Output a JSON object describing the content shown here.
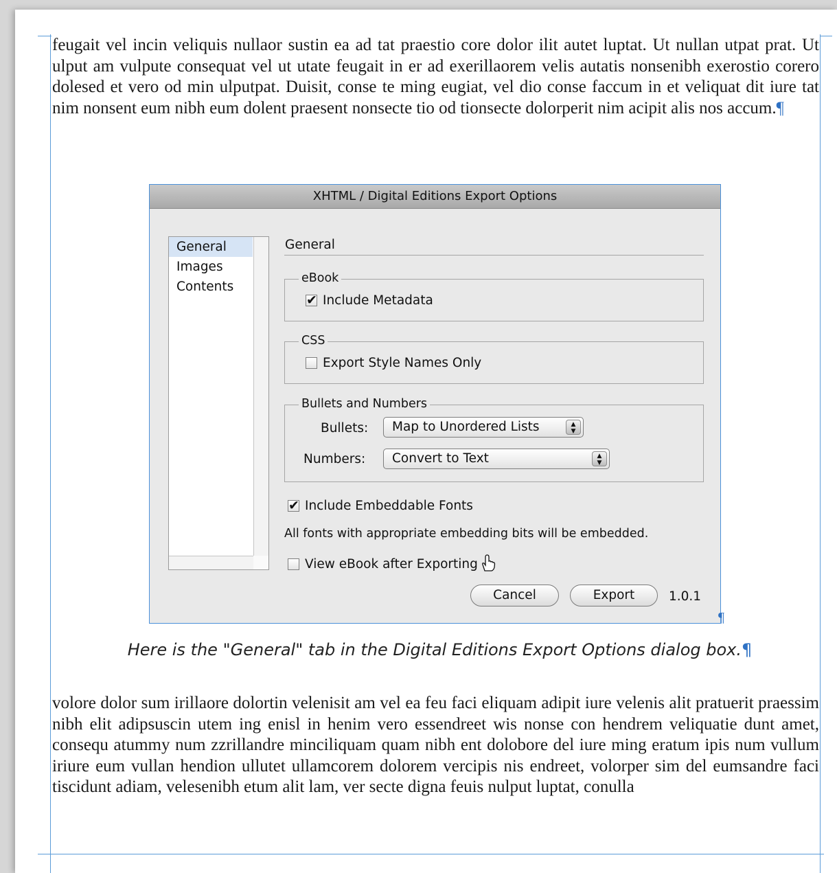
{
  "paragraph_top": "feugait vel incin veliquis nullaor sustin ea ad tat praestio core dolor ilit autet luptat. Ut nullan utpat prat. Ut ulput am vulpute consequat vel ut utate feugait in er ad exerillaorem velis autatis nonsenibh exerostio corero dolesed et vero od min ulputpat. Duisit, conse te ming eugiat, vel dio conse faccum in et veliquat dit iure tat nim nonsent eum nibh eum dolent praesent nonsecte tio od tionsecte dolorperit nim acipit alis nos accum.",
  "pilcrow": "¶",
  "dialog": {
    "title": "XHTML / Digital Editions Export Options",
    "sidebar_items": [
      "General",
      "Images",
      "Contents"
    ],
    "section_title": "General",
    "ebook_group": {
      "legend": "eBook",
      "include_metadata_label": "Include Metadata",
      "include_metadata_checked": true
    },
    "css_group": {
      "legend": "CSS",
      "export_style_names_label": "Export Style Names Only",
      "export_style_names_checked": false
    },
    "bullets_group": {
      "legend": "Bullets and Numbers",
      "bullets_label": "Bullets:",
      "bullets_value": "Map to Unordered Lists",
      "numbers_label": "Numbers:",
      "numbers_value": "Convert to Text"
    },
    "embed_fonts_label": "Include Embeddable Fonts",
    "embed_fonts_checked": true,
    "embed_note": "All fonts with appropriate embedding bits will be embedded.",
    "view_ebook_label": "View eBook after Exporting",
    "view_ebook_checked": false,
    "cancel_label": "Cancel",
    "export_label": "Export",
    "version": "1.0.1"
  },
  "caption": "Here is the \"General\" tab in the Digital Editions Export Options dialog box.",
  "paragraph_bottom": "volore dolor sum irillaore dolortin velenisit am vel ea feu faci eliquam adipit iure velenis alit pratuerit praessim nibh elit adipsuscin utem ing enisl in henim vero essendreet wis nonse con hendrem veliquatie dunt amet, consequ atummy num zzrillandre minciliquam quam nibh ent dolobore del iure ming eratum ipis num vullum iriure eum vullan hendion ullutet ullamcorem dolorem vercipis nis endreet, volorper sim del eumsandre faci tiscidunt adiam, velesenibh etum alit lam, ver secte digna feuis nulput luptat, conulla"
}
